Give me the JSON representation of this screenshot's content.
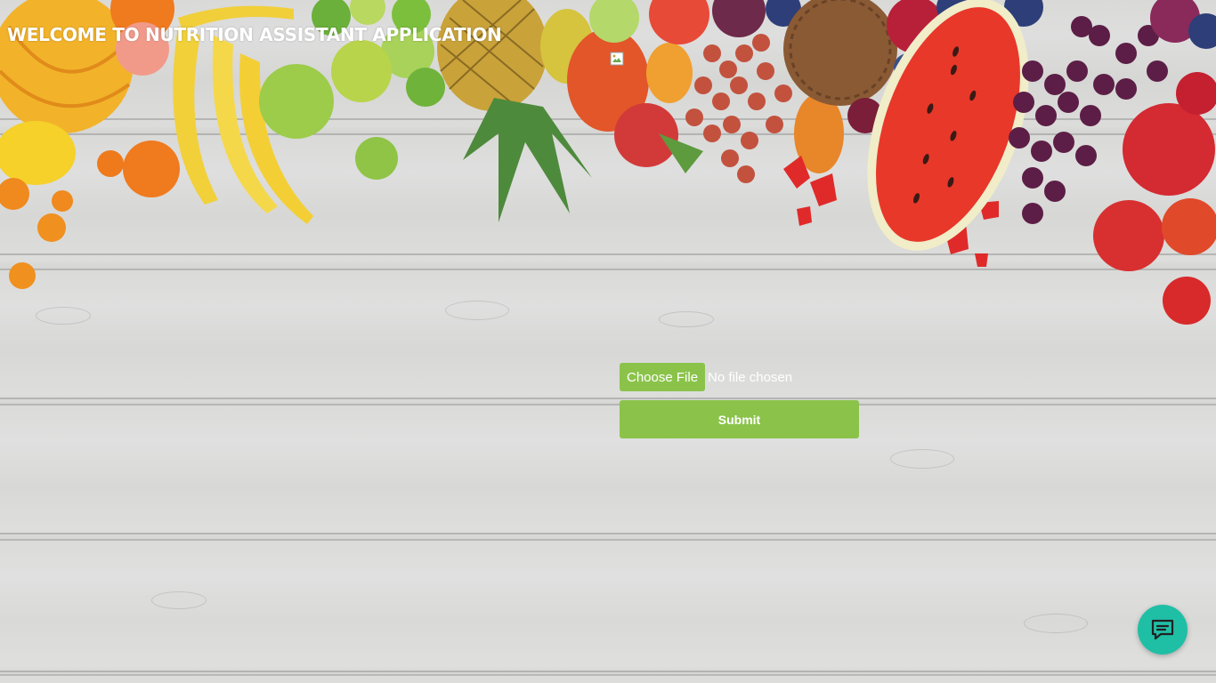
{
  "header": {
    "title": "WELCOME TO NUTRITION ASSISTANT APPLICATION"
  },
  "upload": {
    "choose_file_label": "Choose File",
    "status_text": "No file chosen"
  },
  "form": {
    "submit_label": "Submit"
  },
  "chat": {
    "icon": "chat-bubble-icon"
  },
  "colors": {
    "accent_green": "#8bc34a",
    "chat_teal": "#1fbfa6",
    "title_text": "#ffffff"
  }
}
